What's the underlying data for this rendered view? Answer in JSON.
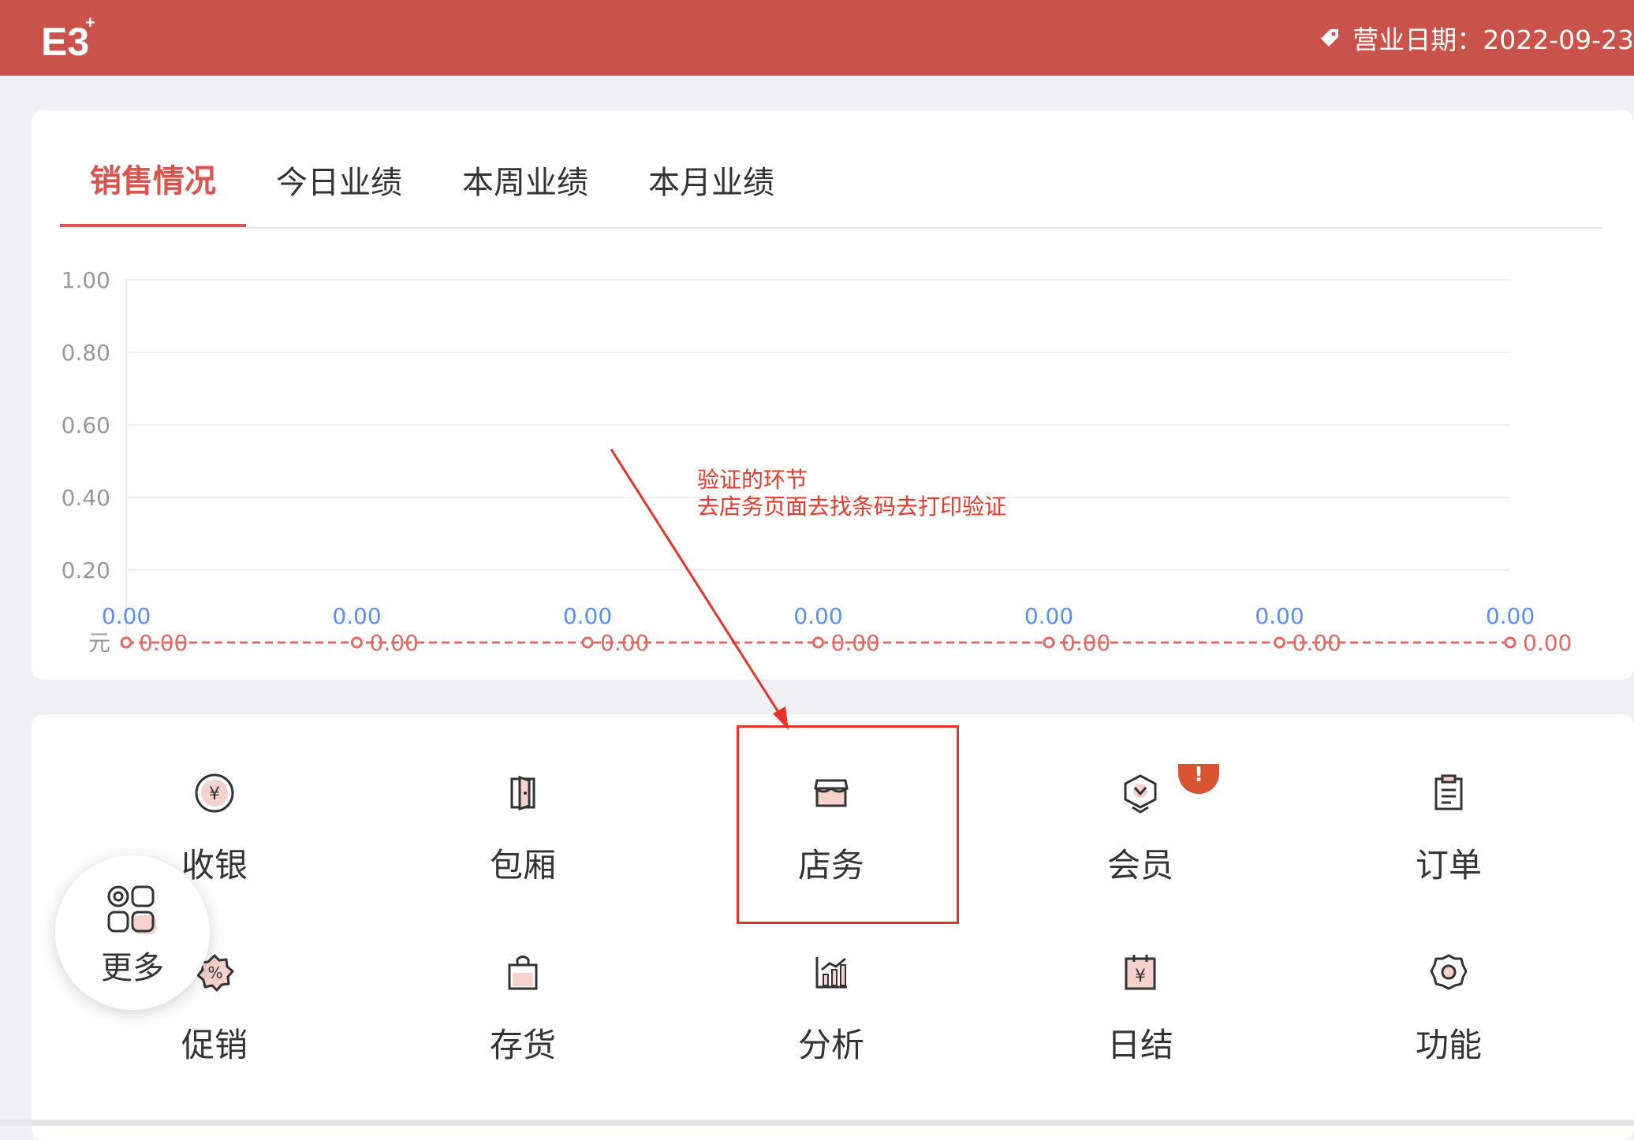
{
  "header": {
    "logo_text": "E3",
    "business_date_label": "营业日期：2022-09-23"
  },
  "sales": {
    "tabs": [
      {
        "label": "销售情况",
        "active": true
      },
      {
        "label": "今日业绩",
        "active": false
      },
      {
        "label": "本周业绩",
        "active": false
      },
      {
        "label": "本月业绩",
        "active": false
      }
    ]
  },
  "chart_data": {
    "type": "line",
    "y_ticks": [
      "1.00",
      "0.80",
      "0.60",
      "0.40",
      "0.20"
    ],
    "ylim": [
      0,
      1
    ],
    "unit_label": "元",
    "grid": true,
    "series": [
      {
        "color": "#e06a63",
        "values": [
          0,
          0,
          0,
          0,
          0,
          0,
          0
        ]
      }
    ],
    "data_labels_blue": [
      "0.00",
      "0.00",
      "0.00",
      "0.00",
      "0.00",
      "0.00",
      "0.00"
    ],
    "data_labels_red": [
      "0.00",
      "0.00",
      "0.00",
      "0.00",
      "0.00",
      "0.00",
      "0.00"
    ]
  },
  "functions": {
    "items": [
      {
        "label": "收银",
        "icon": "cashier-icon"
      },
      {
        "label": "包厢",
        "icon": "room-icon"
      },
      {
        "label": "店务",
        "icon": "store-icon"
      },
      {
        "label": "会员",
        "icon": "member-icon"
      },
      {
        "label": "订单",
        "icon": "order-icon"
      },
      {
        "label": "促销",
        "icon": "promotion-icon"
      },
      {
        "label": "存货",
        "icon": "inventory-icon"
      },
      {
        "label": "分析",
        "icon": "analysis-icon"
      },
      {
        "label": "日结",
        "icon": "daily-settlement-icon"
      },
      {
        "label": "功能",
        "icon": "settings-icon"
      }
    ],
    "member_badge": "!",
    "more_label": "更多"
  },
  "annotation": {
    "line1": "验证的环节",
    "line2": "去店务页面去找条码去打印验证"
  },
  "colors": {
    "header": "#c9534a",
    "accent": "#d9534f",
    "chart_line": "#e06a63",
    "chart_label_blue": "#5b8ff9",
    "annotation": "#e5342a"
  }
}
